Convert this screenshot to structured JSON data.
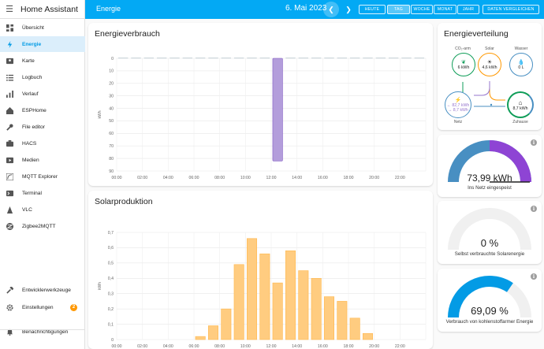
{
  "app_title": "Home Assistant",
  "sidebar": {
    "items": [
      {
        "label": "Übersicht",
        "icon": "dashboard-icon"
      },
      {
        "label": "Energie",
        "icon": "lightning-icon",
        "active": true
      },
      {
        "label": "Karte",
        "icon": "map-icon"
      },
      {
        "label": "Logbuch",
        "icon": "list-icon"
      },
      {
        "label": "Verlauf",
        "icon": "chart-icon"
      },
      {
        "label": "ESPHome",
        "icon": "esphome-icon"
      },
      {
        "label": "File editor",
        "icon": "wrench-icon"
      },
      {
        "label": "HACS",
        "icon": "hacs-icon"
      },
      {
        "label": "Medien",
        "icon": "media-icon"
      },
      {
        "label": "MQTT Explorer",
        "icon": "mqtt-icon"
      },
      {
        "label": "Terminal",
        "icon": "terminal-icon"
      },
      {
        "label": "VLC",
        "icon": "vlc-icon"
      },
      {
        "label": "Zigbee2MQTT",
        "icon": "zigbee-icon"
      }
    ],
    "bottom": [
      {
        "label": "Entwicklerwerkzeuge",
        "icon": "hammer-icon"
      },
      {
        "label": "Einstellungen",
        "icon": "cog-icon",
        "badge": "2"
      },
      {
        "label": "Benachrichtigungen",
        "icon": "bell-icon"
      }
    ]
  },
  "header": {
    "title": "Energie",
    "date": "6. Mai 2023",
    "buttons": [
      "HEUTE",
      "TAG",
      "WOCHE",
      "MONAT",
      "JAHR"
    ],
    "selected": "TAG",
    "compare": "DATEN VERGLEICHEN"
  },
  "colors": {
    "accent": "#03a9f4",
    "solar": "#ffb74d",
    "solar_fill": "#ffcc80",
    "grid_return": "#9575cd",
    "grid": "#488fc2",
    "fossil": "#0f9d58"
  },
  "energieverbrauch": {
    "title": "Energieverbrauch",
    "chart_data": {
      "type": "bar",
      "ylabel": "kWh",
      "yticks": [
        "0",
        "10",
        "20",
        "30",
        "40",
        "50",
        "60",
        "70",
        "80",
        "90"
      ],
      "xticks": [
        "00:00",
        "02:00",
        "04:00",
        "06:00",
        "08:00",
        "10:00",
        "12:00",
        "14:00",
        "16:00",
        "18:00",
        "20:00",
        "22:00"
      ],
      "ylim": [
        0,
        90
      ],
      "series": [
        {
          "values": [
            0,
            0,
            0,
            0,
            0,
            0,
            0,
            0,
            0,
            0,
            0,
            0,
            -82,
            0,
            0,
            0,
            0,
            0,
            0,
            0,
            0,
            0,
            0,
            0
          ]
        }
      ]
    }
  },
  "solarproduktion": {
    "title": "Solarproduktion",
    "chart_data": {
      "type": "bar",
      "ylabel": "kWh",
      "yticks": [
        "0",
        "0,1",
        "0,2",
        "0,3",
        "0,4",
        "0,5",
        "0,6",
        "0,7"
      ],
      "xticks": [
        "00:00",
        "02:00",
        "04:00",
        "06:00",
        "08:00",
        "10:00",
        "12:00",
        "14:00",
        "16:00",
        "18:00",
        "20:00",
        "22:00"
      ],
      "ylim": [
        0,
        0.7
      ],
      "values": [
        0,
        0,
        0,
        0,
        0,
        0,
        0.02,
        0.09,
        0.2,
        0.49,
        0.66,
        0.56,
        0.37,
        0.58,
        0.45,
        0.4,
        0.28,
        0.25,
        0.14,
        0.04,
        0,
        0,
        0,
        0
      ]
    }
  },
  "energieverteilung": {
    "title": "Energieverteilung",
    "nodes": {
      "fossil": {
        "label": "CO₂-arm",
        "value": "6 kWh"
      },
      "solar": {
        "label": "Solar",
        "value": "4,6 kWh"
      },
      "wasser": {
        "label": "Wasser",
        "value": "0 L"
      },
      "netz": {
        "label": "Netz",
        "value_in": "← 82,7 kWh",
        "value_out": "→ 8,7 kWh"
      },
      "zuhause": {
        "label": "Zuhause",
        "value": "8,7 kWh"
      }
    }
  },
  "gauges": [
    {
      "value": "73,99 kWh",
      "label": "Ins Netz eingespeist",
      "level": 0.5
    },
    {
      "value": "0 %",
      "label": "Selbst verbrauchte Solarenergie",
      "level": 0
    },
    {
      "value": "69,09 %",
      "label": "Verbrauch von kohlenstoffarmer Energie",
      "level": 0.69
    }
  ]
}
